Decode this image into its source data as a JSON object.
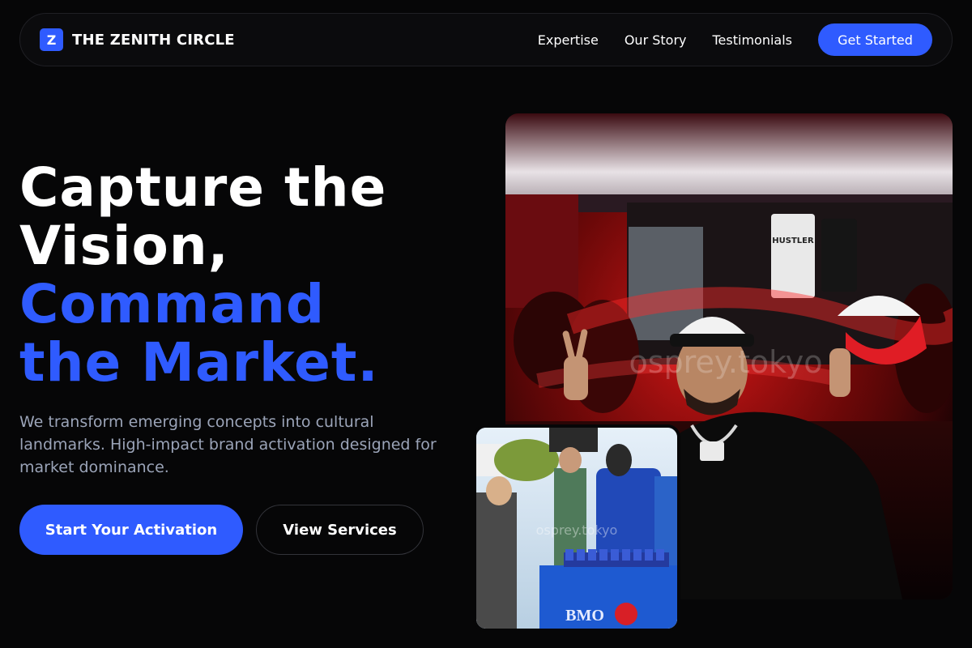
{
  "nav": {
    "logo_letter": "Z",
    "brand_name": "THE ZENITH CIRCLE",
    "links": [
      "Expertise",
      "Our Story",
      "Testimonials"
    ],
    "cta_label": "Get Started"
  },
  "hero": {
    "headline_lines": [
      "Capture the",
      "Vision,"
    ],
    "headline_accent_lines": [
      "Command",
      "the Market."
    ],
    "subtext": "We transform emerging concepts into cultural landmarks. High-impact brand activation designed for market dominance.",
    "primary_button": "Start Your Activation",
    "secondary_button": "View Services"
  },
  "images": {
    "main_photo": {
      "watermark": "osprey.tokyo",
      "shirt_text": "HUSTLER",
      "alt": "DJ with cap making peace sign in red-lit venue"
    },
    "inset_photo": {
      "watermark": "osprey.tokyo",
      "table_brand": "BMO",
      "alt": "Brand activation booth outdoors"
    }
  },
  "colors": {
    "accent": "#2f5bff",
    "background": "#060607",
    "muted_text": "#9ba4b8"
  }
}
